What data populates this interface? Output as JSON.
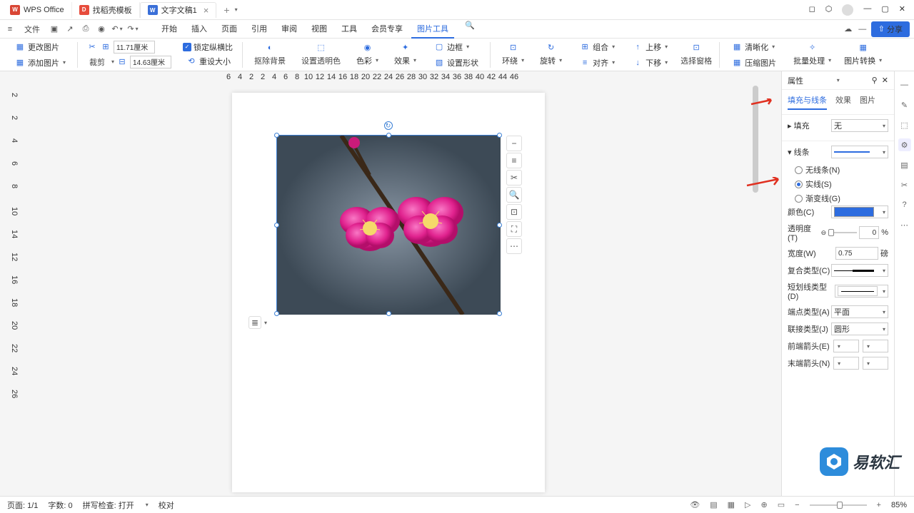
{
  "titlebar": {
    "app": "WPS Office",
    "tab1": "找稻壳模板",
    "tab2": "文字文稿1"
  },
  "menubar": {
    "file": "文件",
    "start": "开始",
    "insert": "插入",
    "page": "页面",
    "reference": "引用",
    "review": "审阅",
    "view": "视图",
    "tool": "工具",
    "member": "会员专享",
    "picture_tool": "图片工具",
    "share": "分享"
  },
  "ribbon": {
    "change_pic": "更改图片",
    "add_pic": "添加图片",
    "crop": "裁剪",
    "w_val": "11.71厘米",
    "h_val": "14.63厘米",
    "lock_ratio": "锁定纵横比",
    "reset_size": "重设大小",
    "remove_bg": "抠除背景",
    "set_trans": "设置透明色",
    "color": "色彩",
    "effect": "效果",
    "border": "边框",
    "shadow": "设置形状",
    "wrap": "环绕",
    "rotate": "旋转",
    "align": "对齐",
    "group": "组合",
    "up": "上移",
    "down": "下移",
    "select_pane": "选择窗格",
    "format": "清晰化",
    "compress": "压缩图片",
    "batch": "批量处理",
    "pic_convert": "图片转换"
  },
  "prop": {
    "title": "属性",
    "tab_fill": "填充与线条",
    "tab_effect": "效果",
    "tab_pic": "图片",
    "fill": "填充",
    "fill_none": "无",
    "line": "线条",
    "no_line": "无线条(N)",
    "solid": "实线(S)",
    "gradient": "渐变线(G)",
    "color": "颜色(C)",
    "trans": "透明度(T)",
    "trans_val": "0",
    "trans_unit": "%",
    "width": "宽度(W)",
    "width_val": "0.75",
    "width_unit": "磅",
    "compound": "复合类型(C)",
    "dash": "短划线类型(D)",
    "cap": "端点类型(A)",
    "cap_val": "平面",
    "join": "联接类型(J)",
    "join_val": "圆形",
    "arrow_start": "前端箭头(E)",
    "arrow_end": "末端箭头(N)"
  },
  "status": {
    "page": "页面: 1/1",
    "words": "字数: 0",
    "spell": "拼写检查: 打开",
    "proof": "校对",
    "zoom": "85%"
  },
  "ruler_h": [
    "6",
    "4",
    "2",
    "2",
    "4",
    "6",
    "8",
    "10",
    "12",
    "14",
    "16",
    "18",
    "20",
    "22",
    "24",
    "26",
    "28",
    "30",
    "32",
    "34",
    "36",
    "38",
    "40",
    "42",
    "44",
    "46"
  ],
  "ruler_v": [
    "2",
    "2",
    "4",
    "6",
    "8",
    "10",
    "14",
    "12",
    "16",
    "18",
    "20",
    "22",
    "24",
    "26"
  ],
  "watermark": "易软汇"
}
